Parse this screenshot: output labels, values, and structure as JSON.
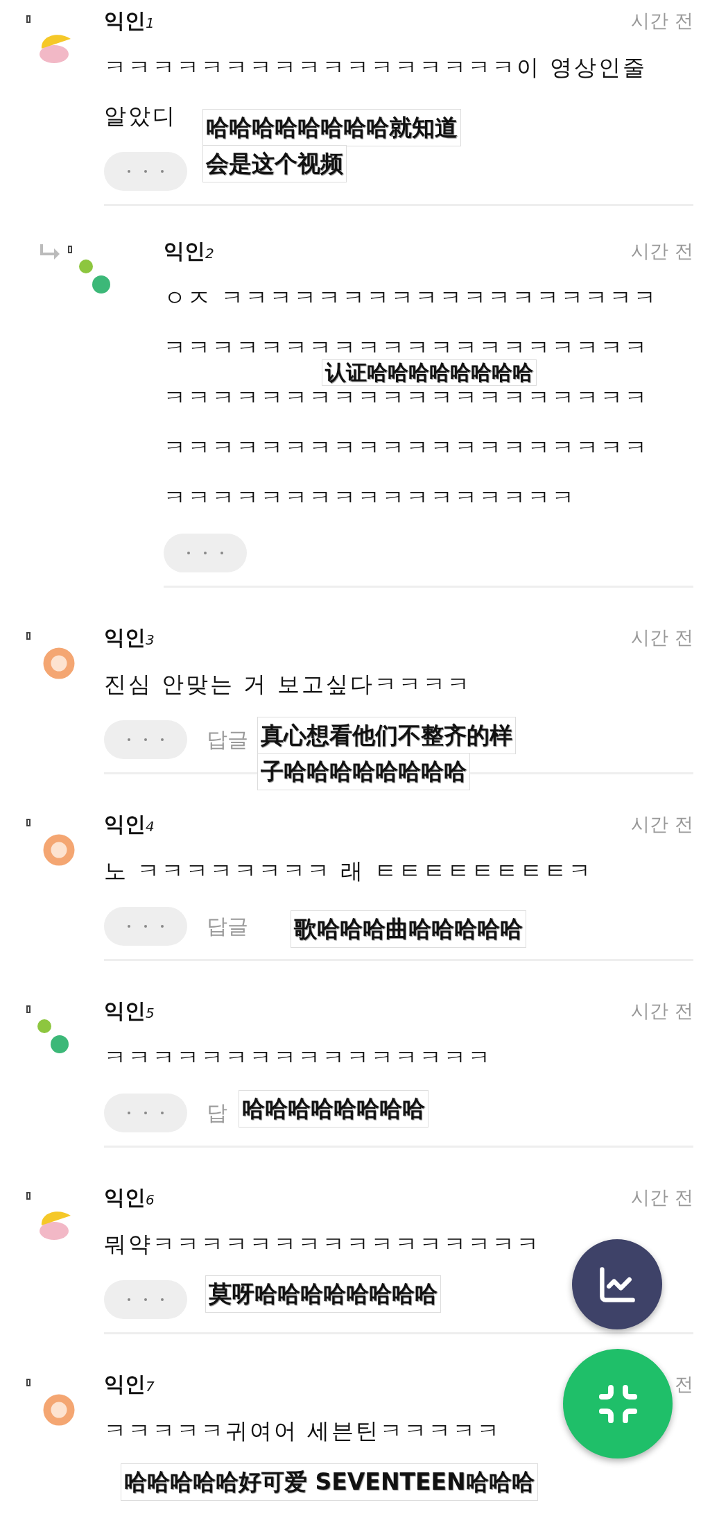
{
  "comments": [
    {
      "kind": "blob",
      "reply": false,
      "name": "익인$_{1}$",
      "time": "시간 전",
      "lines": [
        "ㅋㅋㅋㅋㅋㅋㅋㅋㅋㅋㅋㅋㅋㅋㅋㅋㅋ이 영상인줄",
        "알았디"
      ],
      "subtitle": [
        "哈哈哈哈哈哈哈哈就知道",
        "会是这个视频"
      ]
    },
    {
      "kind": "dots",
      "reply": true,
      "name": "익인$_{2}$",
      "time": "시간 전",
      "lines": [
        "ㅇㅈ ㅋㅋㅋㅋㅋㅋㅋㅋㅋㅋㅋㅋㅋㅋㅋㅋㅋㅋ",
        "ㅋㅋㅋㅋㅋㅋㅋㅋㅋㅋㅋㅋㅋㅋㅋㅋㅋㅋㅋㅋ",
        "ㅋㅋㅋㅋㅋㅋㅋㅋㅋㅋㅋㅋㅋㅋㅋㅋㅋㅋㅋㅋ",
        "ㅋㅋㅋㅋㅋㅋㅋㅋㅋㅋㅋㅋㅋㅋㅋㅋㅋㅋㅋㅋ",
        "ㅋㅋㅋㅋㅋㅋㅋㅋㅋㅋㅋㅋㅋㅋㅋㅋㅋ"
      ],
      "subtitle": [
        "认证哈哈哈哈哈哈哈哈"
      ]
    },
    {
      "kind": "ring",
      "reply": false,
      "name": "익인$_{3}$",
      "time": "시간 전",
      "lines": [
        "진심 안맞는 거 보고싶다ㅋㅋㅋㅋ"
      ],
      "reply_label": "답글",
      "subtitle": [
        "真心想看他们不整齐的样",
        "子哈哈哈哈哈哈哈哈"
      ]
    },
    {
      "kind": "ring",
      "reply": false,
      "name": "익인$_{4}$",
      "time": "시간 전",
      "lines": [
        "노 ㅋㅋㅋㅋㅋㅋㅋㅋ 래 ㅌㅌㅌㅌㅌㅌㅌㅌㅋ"
      ],
      "reply_label": "답글",
      "subtitle": [
        "歌哈哈哈曲哈哈哈哈哈"
      ]
    },
    {
      "kind": "dots",
      "reply": false,
      "name": "익인$_{5}$",
      "time": "시간 전",
      "lines": [
        "ㅋㅋㅋㅋㅋㅋㅋㅋㅋㅋㅋㅋㅋㅋㅋㅋ"
      ],
      "reply_label": "답",
      "subtitle": [
        "哈哈哈哈哈哈哈哈"
      ]
    },
    {
      "kind": "blob",
      "reply": false,
      "name": "익인$_{6}$",
      "time": "시간 전",
      "lines": [
        "뭐약ㅋㅋㅋㅋㅋㅋㅋㅋㅋㅋㅋㅋㅋㅋㅋㅋ"
      ],
      "subtitle": [
        "莫呀哈哈哈哈哈哈哈哈"
      ]
    },
    {
      "kind": "ring",
      "reply": false,
      "name": "익인$_{7}$",
      "time": "전",
      "lines": [
        "ㅋㅋㅋㅋㅋ귀여어 세븐틴ㅋㅋㅋㅋㅋ"
      ],
      "subtitle": [
        "哈哈哈哈哈好可爱 SEVENTEEN哈哈哈"
      ]
    }
  ],
  "fabs": [
    {
      "kind": "chart"
    },
    {
      "kind": "collapse"
    }
  ]
}
